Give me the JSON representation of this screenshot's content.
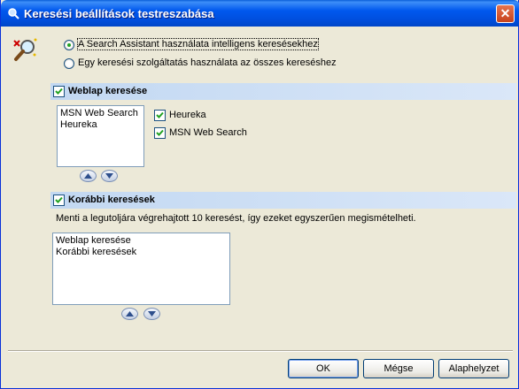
{
  "window": {
    "title": "Keresési beállítások testreszabása",
    "close": "✕"
  },
  "mode": {
    "assistant_label": "A Search Assistant használata intelligens keresésekhez",
    "single_label": "Egy keresési szolgáltatás használata az összes kereséshez",
    "selected": "assistant"
  },
  "web": {
    "header": "Weblap keresése",
    "list": [
      "MSN Web Search",
      "Heureka"
    ],
    "options": [
      {
        "label": "Heureka",
        "checked": true
      },
      {
        "label": "MSN Web Search",
        "checked": true
      }
    ]
  },
  "previous": {
    "header": "Korábbi keresések",
    "description": "Menti a legutoljára végrehajtott 10 keresést, így ezeket egyszerűen megismételheti.",
    "list": [
      "Weblap keresése",
      "Korábbi keresések"
    ]
  },
  "buttons": {
    "ok": "OK",
    "cancel": "Mégse",
    "reset": "Alaphelyzet"
  }
}
